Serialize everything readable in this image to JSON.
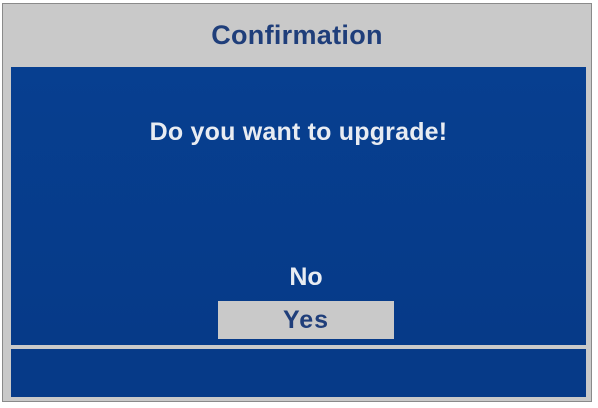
{
  "dialog": {
    "title": "Confirmation",
    "message": "Do you want to upgrade!",
    "options": [
      {
        "label": "No",
        "selected": false
      },
      {
        "label": "Yes",
        "selected": true
      }
    ],
    "status_text": ""
  },
  "colors": {
    "frame": "#c9c9c9",
    "panel": "#063c8c",
    "title_text": "#1f3e7a",
    "body_text": "#e8ecf2",
    "selected_bg": "#c9c9c9"
  }
}
